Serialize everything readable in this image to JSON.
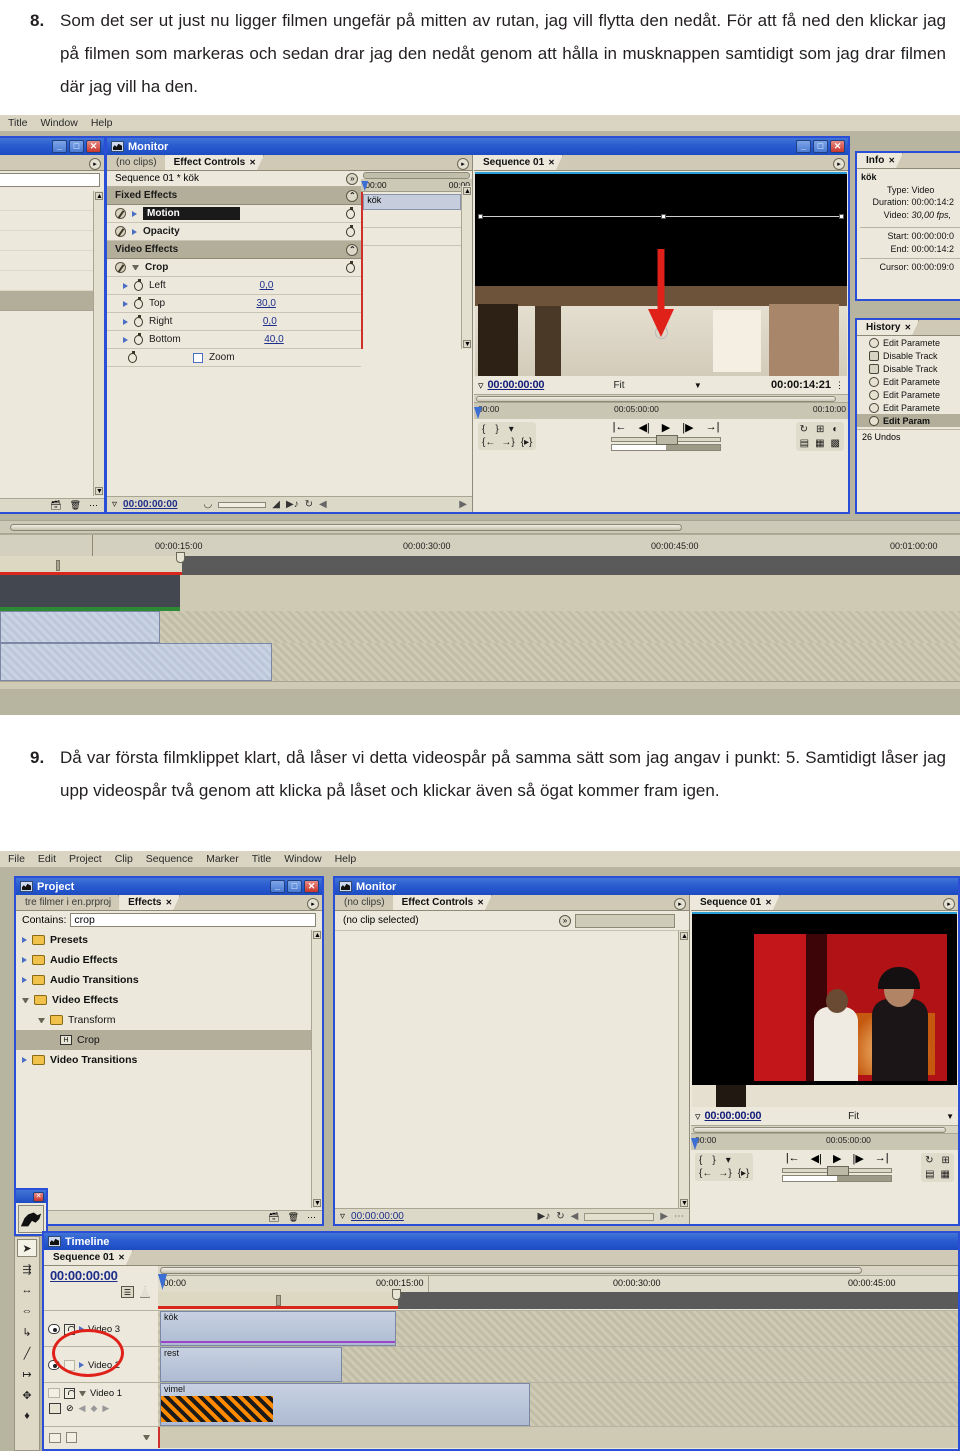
{
  "document": {
    "steps": [
      {
        "number": "8.",
        "text": "Som det ser ut just nu ligger filmen ungefär på mitten av rutan, jag vill flytta den nedåt. För att få ned den klickar jag på filmen som markeras och sedan drar jag den nedåt genom att hålla in musknappen samtidigt som jag drar filmen där jag vill ha den."
      },
      {
        "number": "9.",
        "text": "Då var första filmklippet klart, då låser vi detta videospår på samma sätt som jag angav i punkt: 5. Samtidigt låser jag upp videospår två genom att klicka på låset och klickar även så ögat kommer fram igen."
      }
    ]
  },
  "screenshot1": {
    "menubar": [
      "Title",
      "Window",
      "Help"
    ],
    "project_window": {
      "window_buttons": {
        "minimize": "_",
        "maximize": "□",
        "close": "✕"
      }
    },
    "monitor_window": {
      "title": "Monitor",
      "tabs": [
        {
          "label": "(no clips)",
          "active": false
        },
        {
          "label": "Effect Controls",
          "active": true,
          "close": "✕"
        }
      ],
      "effect_controls": {
        "clip_header": "Sequence 01 * kök",
        "expand_icon": "»",
        "mini_timeline": {
          "left_label": "00:00",
          "right_label": "00:00",
          "clip_name": "kök"
        },
        "sections": [
          {
            "label": "Fixed Effects",
            "collapse": "⌃"
          },
          {
            "label": "Motion",
            "type": "effect",
            "selected": true
          },
          {
            "label": "Opacity",
            "type": "effect",
            "selected": false
          },
          {
            "label": "Video Effects",
            "collapse": "⌃"
          },
          {
            "label": "Crop",
            "type": "effect",
            "expanded": true
          }
        ],
        "crop_params": [
          {
            "name": "Left",
            "value": "0,0"
          },
          {
            "name": "Top",
            "value": "30,0"
          },
          {
            "name": "Right",
            "value": "0,0"
          },
          {
            "name": "Bottom",
            "value": "40,0"
          }
        ],
        "zoom_checkbox": {
          "label": "Zoom",
          "checked": false
        },
        "footer_timecode": "00:00:00:00"
      }
    },
    "sequence_monitor": {
      "tab": "Sequence 01",
      "tab_close": "✕",
      "current_time": "00:00:00:00",
      "fit_label": "Fit",
      "duration": "00:00:14:21",
      "ruler_labels": [
        "00:00",
        "00:05:00:00",
        "00:10:00"
      ]
    },
    "info_panel": {
      "tab": "Info",
      "tab_close": "✕",
      "clip_name": "kök",
      "rows": [
        {
          "label": "Type:",
          "value": "Video"
        },
        {
          "label": "Duration:",
          "value": "00:00:14:2"
        },
        {
          "label": "Video:",
          "value": "30,00 fps,"
        }
      ],
      "rows2": [
        {
          "label": "Start:",
          "value": "00:00:00:0"
        },
        {
          "label": "End:",
          "value": "00:00:14:2"
        }
      ],
      "cursor": {
        "label": "Cursor:",
        "value": "00:00:09:0"
      }
    },
    "history_panel": {
      "tab": "History",
      "tab_close": "✕",
      "items": [
        {
          "label": "Edit Paramete",
          "icon": "edit-parameter-icon",
          "active": false
        },
        {
          "label": "Disable Track",
          "icon": "disable-track-icon",
          "active": false
        },
        {
          "label": "Disable Track",
          "icon": "disable-track-icon",
          "active": false
        },
        {
          "label": "Edit Paramete",
          "icon": "edit-parameter-icon",
          "active": false
        },
        {
          "label": "Edit Paramete",
          "icon": "edit-parameter-icon",
          "active": false
        },
        {
          "label": "Edit Paramete",
          "icon": "edit-parameter-icon",
          "active": false
        },
        {
          "label": "Edit Param",
          "icon": "edit-parameter-icon",
          "active": true
        }
      ],
      "undo_count": "26 Undos"
    },
    "timeline_ruler_labels": [
      "00:00:15:00",
      "00:00:30:00",
      "00:00:45:00",
      "00:01:00:00"
    ]
  },
  "screenshot2": {
    "menubar": [
      "File",
      "Edit",
      "Project",
      "Clip",
      "Sequence",
      "Marker",
      "Title",
      "Window",
      "Help"
    ],
    "project_window": {
      "title": "Project",
      "window_buttons": {
        "minimize": "_",
        "maximize": "□",
        "close": "✕"
      },
      "tabs": [
        {
          "label": "tre filmer i en.prproj",
          "active": false
        },
        {
          "label": "Effects",
          "active": true,
          "close": "✕"
        }
      ],
      "contains_label": "Contains:",
      "contains_value": "crop",
      "tree": [
        {
          "label": "Presets",
          "bold": true,
          "depth": 0,
          "expanded": false,
          "icon": "presets-folder-icon"
        },
        {
          "label": "Audio Effects",
          "bold": true,
          "depth": 0,
          "expanded": false,
          "icon": "folder-icon"
        },
        {
          "label": "Audio Transitions",
          "bold": true,
          "depth": 0,
          "expanded": false,
          "icon": "folder-icon"
        },
        {
          "label": "Video Effects",
          "bold": true,
          "depth": 0,
          "expanded": true,
          "icon": "folder-icon"
        },
        {
          "label": "Transform",
          "bold": false,
          "depth": 1,
          "expanded": true,
          "icon": "folder-icon"
        },
        {
          "label": "Crop",
          "bold": false,
          "depth": 2,
          "expanded": false,
          "icon": "effect-icon",
          "selected": true
        },
        {
          "label": "Video Transitions",
          "bold": true,
          "depth": 0,
          "expanded": false,
          "icon": "folder-icon"
        }
      ]
    },
    "monitor_window": {
      "title": "Monitor",
      "tabs": [
        {
          "label": "(no clips)",
          "active": false
        },
        {
          "label": "Effect Controls",
          "active": true,
          "close": "✕"
        }
      ],
      "no_clip_text": "(no clip selected)",
      "expand_icon": "»",
      "footer_timecode": "00:00:00:00"
    },
    "sequence_monitor": {
      "tab": "Sequence 01",
      "tab_close": "✕",
      "current_time": "00:00:00:00",
      "fit_label": "Fit",
      "ruler_labels": [
        "00:00",
        "00:05:00:00"
      ]
    },
    "timeline_window": {
      "title": "Timeline",
      "tab": "Sequence 01",
      "tab_close": "✕",
      "playhead_timecode": "00:00:00:00",
      "ruler_labels": [
        ":00:00",
        "00:00:15:00",
        "00:00:30:00",
        "00:00:45:00"
      ],
      "tracks": [
        {
          "name": "Video 3",
          "clip": "kök",
          "eye": true,
          "lock": true,
          "highlighted": true
        },
        {
          "name": "Video 2",
          "clip": "rest",
          "eye": true,
          "lock": false,
          "highlighted": true
        },
        {
          "name": "Video 1",
          "clip": "vimel",
          "eye": false,
          "lock": true,
          "highlighted": false
        }
      ]
    },
    "tools": [
      "selection-tool-icon",
      "track-select-tool-icon",
      "ripple-edit-tool-icon",
      "rolling-edit-tool-icon",
      "rate-stretch-tool-icon",
      "razor-tool-icon",
      "slip-tool-icon",
      "slide-tool-icon",
      "pen-tool-icon"
    ]
  },
  "colors": {
    "titlebar_blue": "#2a5bd0",
    "panel_bg": "#ece8dc",
    "section_bg": "#b3ae99",
    "desktop": "#b7b49f",
    "annotation_red": "#e0211a",
    "value_blue": "#1d2f8a"
  }
}
